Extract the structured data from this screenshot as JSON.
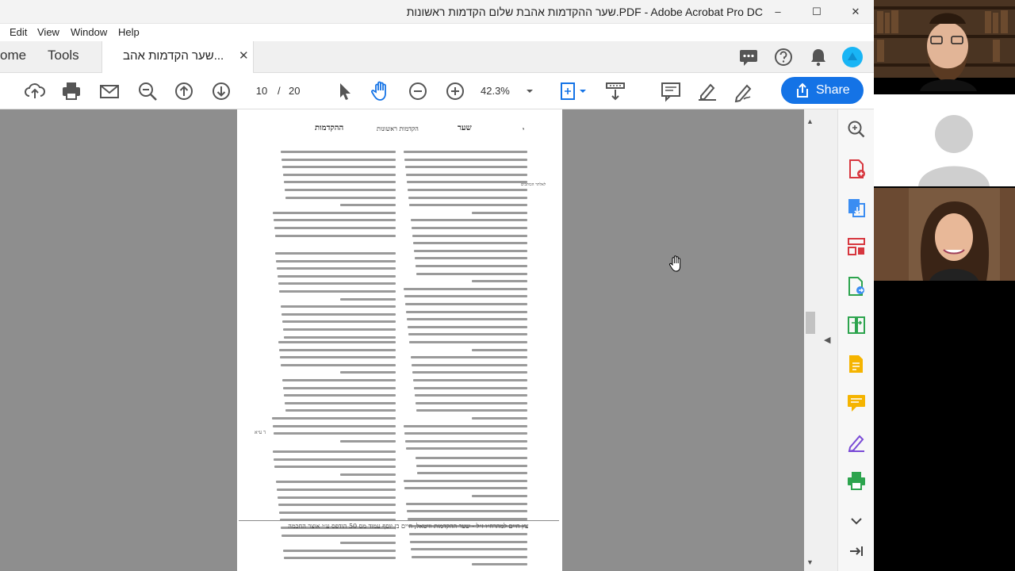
{
  "window": {
    "title": "שער ההקדמות אהבת שלום הקדמות ראשונות.PDF - Adobe Acrobat Pro DC",
    "minimize": "–",
    "maximize": "☐",
    "close": "✕"
  },
  "menu": {
    "items": [
      "Edit",
      "View",
      "Window",
      "Help"
    ]
  },
  "tabs": {
    "home": "ome",
    "tools": "Tools",
    "doc": "שער הקדמות אהב...",
    "doc_close": "✕"
  },
  "toolbar": {
    "page_current": "10",
    "page_sep": "/",
    "page_total": "20",
    "zoom": "42.3%",
    "share_label": "Share"
  },
  "pdf_page": {
    "header_right": "שער",
    "header_center": "הקדמות ראשונות",
    "header_left": "ההקדמות",
    "header_num": "י",
    "margin_note": "לאלתר הכותבים",
    "footnote": "עץ חיים למהרח״ו ז״ל - שער ההקדמות וויטאל, חיים בן יוסף עמוד מס 50 הודפס ע״י אוצר החכמה",
    "side_mark": "ד ע״א"
  },
  "colors": {
    "accent": "#1473e6",
    "green": "#2da44e",
    "red": "#d7373f"
  }
}
